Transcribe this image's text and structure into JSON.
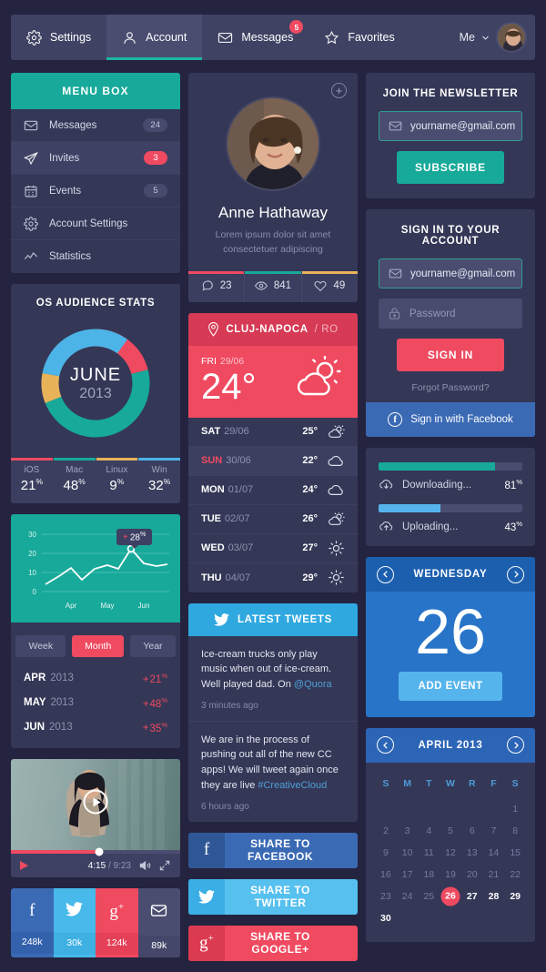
{
  "nav": {
    "items": [
      {
        "label": "Settings",
        "icon": "gear-icon",
        "badge": null,
        "active": false
      },
      {
        "label": "Account",
        "icon": "user-icon",
        "badge": null,
        "active": true
      },
      {
        "label": "Messages",
        "icon": "envelope-icon",
        "badge": "5",
        "active": false
      },
      {
        "label": "Favorites",
        "icon": "star-icon",
        "badge": null,
        "active": false
      }
    ],
    "user_label": "Me"
  },
  "menu_box": {
    "title": "MENU BOX",
    "items": [
      {
        "label": "Messages",
        "count": "24",
        "icon": "envelope-icon",
        "active": false,
        "alert": false
      },
      {
        "label": "Invites",
        "count": "3",
        "icon": "paper-plane-icon",
        "active": true,
        "alert": true
      },
      {
        "label": "Events",
        "count": "5",
        "icon": "calendar-icon",
        "active": false,
        "alert": false
      },
      {
        "label": "Account Settings",
        "count": "",
        "icon": "gear-icon",
        "active": false,
        "alert": false
      },
      {
        "label": "Statistics",
        "count": "",
        "icon": "chart-line-icon",
        "active": false,
        "alert": false
      }
    ]
  },
  "os_stats": {
    "title": "OS AUDIENCE STATS",
    "center_month": "JUNE",
    "center_year": "2013"
  },
  "line_chart": {
    "filters": [
      {
        "label": "Week",
        "active": false
      },
      {
        "label": "Month",
        "active": true
      },
      {
        "label": "Year",
        "active": false
      }
    ],
    "tooltip": "28",
    "tooltip_sign": "+",
    "rows": [
      {
        "month": "APR",
        "year": "2013",
        "sign": "+",
        "delta": "21"
      },
      {
        "month": "MAY",
        "year": "2013",
        "sign": "+",
        "delta": "48"
      },
      {
        "month": "JUN",
        "year": "2013",
        "sign": "+",
        "delta": "35"
      }
    ]
  },
  "video": {
    "current_time": "4:15",
    "separator": " / ",
    "total_time": "9:23",
    "progress_pct": 52
  },
  "socials": [
    {
      "network": "facebook",
      "glyph": "f",
      "count": "248k",
      "color": "#3b6ab5"
    },
    {
      "network": "twitter",
      "glyph": "",
      "count": "30k",
      "color": "#47b9ea"
    },
    {
      "network": "googleplus",
      "glyph": "g",
      "count": "124k",
      "color": "#ef4a60"
    },
    {
      "network": "email",
      "glyph": "",
      "count": "89k",
      "color": "#4a4d70"
    }
  ],
  "profile": {
    "name": "Anne Hathaway",
    "description": "Lorem ipsum dolor sit amet consectetuer adipiscing",
    "stats": [
      {
        "icon": "comment-icon",
        "value": "23",
        "color": "#ef4a60"
      },
      {
        "icon": "eye-icon",
        "value": "841",
        "color": "#17a99a"
      },
      {
        "icon": "heart-icon",
        "value": "49",
        "color": "#e9b35a"
      }
    ]
  },
  "weather": {
    "city": "CLUJ-NAPOCA",
    "country": "/ RO",
    "today_dow": "FRI",
    "today_date": "29/06",
    "today_temp": "24°",
    "today_icon": "sun-cloud-icon",
    "forecast": [
      {
        "dow": "SAT",
        "date": "29/06",
        "temp": "25°",
        "icon": "sun-cloud-icon",
        "highlight": false,
        "sunday": false
      },
      {
        "dow": "SUN",
        "date": "30/06",
        "temp": "22°",
        "icon": "cloud-icon",
        "highlight": true,
        "sunday": true
      },
      {
        "dow": "MON",
        "date": "01/07",
        "temp": "24°",
        "icon": "cloud-icon",
        "highlight": false,
        "sunday": false
      },
      {
        "dow": "TUE",
        "date": "02/07",
        "temp": "26°",
        "icon": "sun-cloud-icon",
        "highlight": false,
        "sunday": false
      },
      {
        "dow": "WED",
        "date": "03/07",
        "temp": "27°",
        "icon": "sun-icon",
        "highlight": false,
        "sunday": false
      },
      {
        "dow": "THU",
        "date": "04/07",
        "temp": "29°",
        "icon": "sun-icon",
        "highlight": false,
        "sunday": false
      }
    ]
  },
  "tweets": {
    "title": "LATEST TWEETS",
    "items": [
      {
        "text": "Ice-cream trucks only play music when out of ice-cream. Well played dad. On ",
        "link": "@Quora",
        "tail": "",
        "time": "3 minutes ago"
      },
      {
        "text": "We are in the process of pushing out all of the new CC apps! We will tweet again once they are live ",
        "link": "#CreativeCloud",
        "tail": "",
        "time": "6 hours ago"
      }
    ]
  },
  "share_buttons": [
    {
      "label": "SHARE TO FACEBOOK",
      "network": "facebook",
      "bg": "#3b6ab5",
      "icon_bg": "#2f5796"
    },
    {
      "label": "SHARE TO TWITTER",
      "network": "twitter",
      "bg": "#56c0ef",
      "icon_bg": "#3aaee5"
    },
    {
      "label": "SHARE TO GOOGLE+",
      "network": "googleplus",
      "bg": "#ef4a60",
      "icon_bg": "#dc3a50"
    }
  ],
  "newsletter": {
    "title": "JOIN THE NEWSLETTER",
    "email_value": "yourname@gmail.com",
    "button": "SUBSCRIBE"
  },
  "signin": {
    "title": "SIGN IN TO YOUR ACCOUNT",
    "email_value": "yourname@gmail.com",
    "password_placeholder": "Password",
    "button": "SIGN IN",
    "forgot": "Forgot Password?",
    "facebook": "Sign in with Facebook"
  },
  "transfers": [
    {
      "label": "Downloading...",
      "pct_text": "81",
      "pct": 81,
      "color": "#17a99a",
      "icon": "cloud-download-icon"
    },
    {
      "label": "Uploading...",
      "pct_text": "43",
      "pct": 43,
      "color": "#56b4ec",
      "icon": "cloud-upload-icon"
    }
  ],
  "day_widget": {
    "title": "WEDNESDAY",
    "number": "26",
    "button": "ADD EVENT"
  },
  "calendar": {
    "title": "APRIL 2013",
    "dow": [
      "S",
      "M",
      "T",
      "W",
      "R",
      "F",
      "S"
    ],
    "weeks": [
      [
        "",
        "",
        "",
        "",
        "",
        "",
        "1"
      ],
      [
        "2",
        "3",
        "4",
        "5",
        "6",
        "7",
        "8"
      ],
      [
        "9",
        "10",
        "11",
        "12",
        "13",
        "14",
        "15"
      ],
      [
        "16",
        "17",
        "18",
        "19",
        "20",
        "21",
        "22"
      ],
      [
        "23",
        "24",
        "25",
        "26",
        "27",
        "28",
        "29"
      ],
      [
        "30",
        "",
        "",
        "",
        "",
        "",
        ""
      ]
    ],
    "today": "26",
    "future_days": [
      "27",
      "28",
      "29",
      "30"
    ]
  },
  "chart_data": [
    {
      "type": "pie",
      "title": "OS AUDIENCE STATS",
      "labels": [
        "iOS",
        "Mac",
        "Linux",
        "Win"
      ],
      "values": [
        21,
        48,
        9,
        32
      ],
      "value_texts": [
        "21%",
        "48%",
        "9%",
        "32%"
      ],
      "colors": [
        "#ef4a60",
        "#17a99a",
        "#e9b35a",
        "#4cb4e7"
      ],
      "center_label": "JUNE 2013",
      "legend": "bottom"
    },
    {
      "type": "line",
      "title": "",
      "x": [
        "Apr",
        "May",
        "Jun"
      ],
      "tick_labels": [
        "Apr",
        "May",
        "Jun"
      ],
      "ylim": [
        0,
        30
      ],
      "yticks": [
        0,
        10,
        20,
        30
      ],
      "values": [
        4,
        8,
        13,
        8,
        14,
        16,
        14,
        23,
        17,
        15,
        15
      ],
      "annotation": "+28%",
      "grid": true,
      "series_color": "#ffffff",
      "background": "#17a99a"
    }
  ]
}
